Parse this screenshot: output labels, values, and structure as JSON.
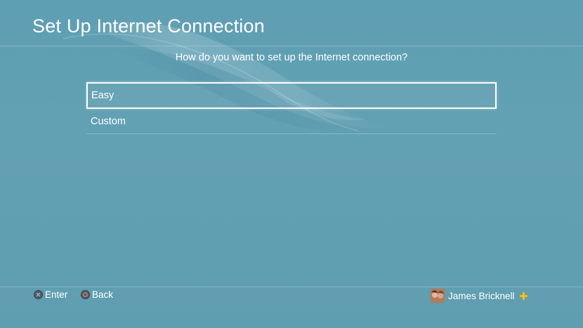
{
  "header": {
    "title": "Set Up Internet Connection"
  },
  "prompt": {
    "question": "How do you want to set up the Internet connection?"
  },
  "options": [
    {
      "label": "Easy",
      "selected": true
    },
    {
      "label": "Custom",
      "selected": false
    }
  ],
  "footer": {
    "enter_label": "Enter",
    "enter_icon": "cross-button-icon",
    "back_label": "Back",
    "back_icon": "circle-button-icon",
    "user_name": "James Bricknell",
    "plus_icon": "playstation-plus-icon"
  },
  "colors": {
    "background": "#62a0b3",
    "text": "#ffffff",
    "plus_gold": "#f2c230"
  }
}
